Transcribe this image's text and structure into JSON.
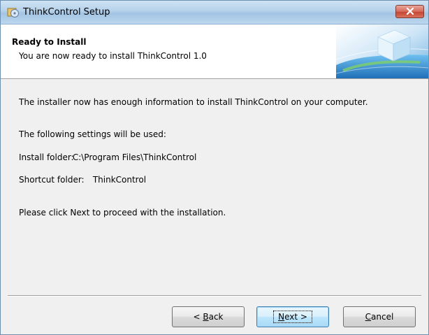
{
  "window": {
    "title": "ThinkControl Setup",
    "icon": "setup-disc-icon",
    "close_icon": "close-x-icon"
  },
  "header": {
    "title": "Ready to Install",
    "subtitle": "You are now ready to install ThinkControl 1.0",
    "banner_icon": "globe-cube-banner"
  },
  "body": {
    "intro": "The installer now has enough information to install ThinkControl on your computer.",
    "settings_heading": "The following settings will be used:",
    "install_folder_label": "Install folder:",
    "install_folder_value": "C:\\Program Files\\ThinkControl",
    "shortcut_folder_label": "Shortcut folder:",
    "shortcut_folder_value": "ThinkControl",
    "proceed_text": "Please click Next to proceed with the installation."
  },
  "buttons": {
    "back": {
      "prefix": "< ",
      "accel": "B",
      "rest": "ack"
    },
    "next": {
      "accel": "N",
      "rest": "ext >"
    },
    "cancel": {
      "accel": "C",
      "rest": "ancel"
    }
  },
  "colors": {
    "title_bar": "#b5d1ea",
    "close_button": "#c44633",
    "dialog_background": "#f0f0f0",
    "default_button_border": "#3c7fb1"
  }
}
